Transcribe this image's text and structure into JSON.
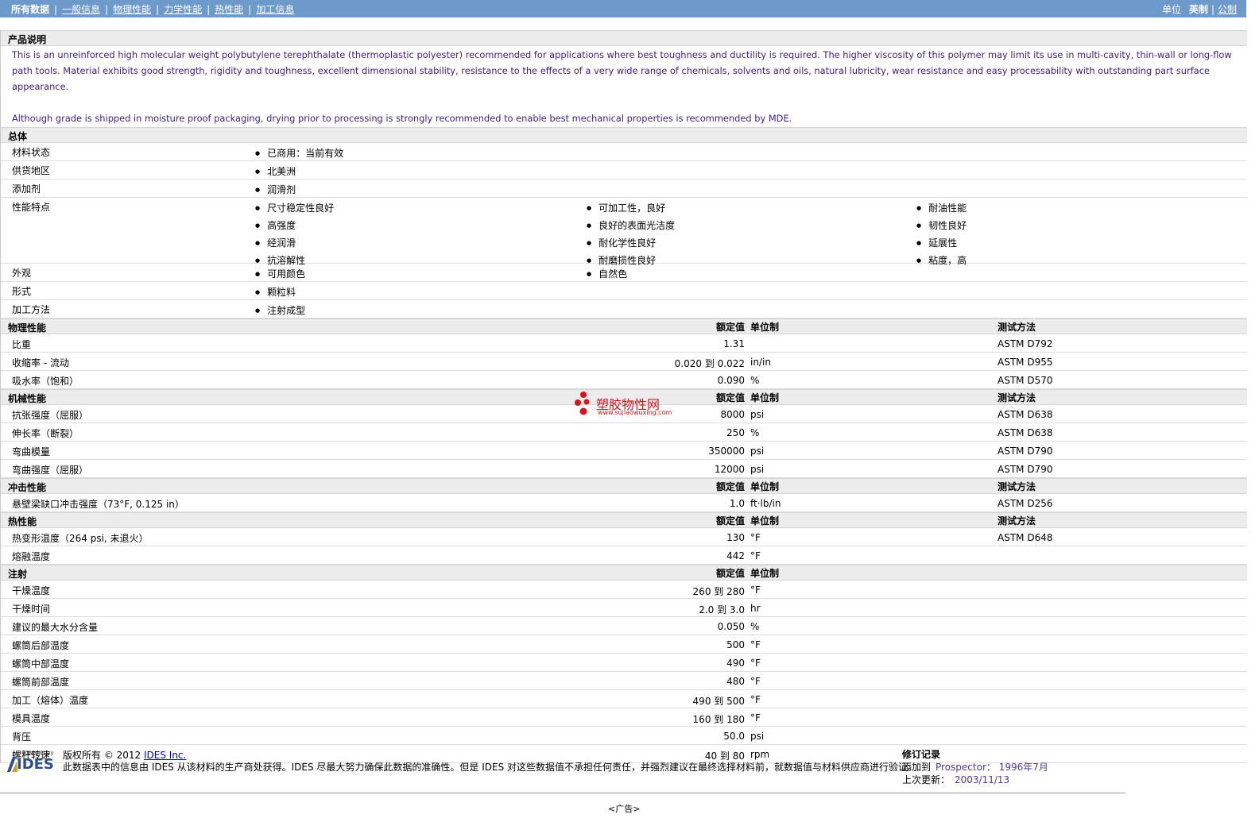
{
  "nav": {
    "items": [
      "所有数据",
      "一般信息",
      "物理性能",
      "力学性能",
      "热性能",
      "加工信息"
    ],
    "units_label": "单位",
    "units": [
      "英制",
      "公制"
    ]
  },
  "description": {
    "title": "产品说明",
    "paragraphs": [
      "This is an unreinforced high molecular weight polybutylene terephthalate (thermoplastic polyester) recommended for applications where best toughness and ductility is required. The higher viscosity of this polymer may limit its use in multi-cavity, thin-wall or long-flow path tools. Material exhibits good strength, rigidity and toughness, excellent dimensional stability, resistance to the effects of a very wide range of chemicals, solvents and oils, natural lubricity, wear resistance and easy processability with outstanding part surface appearance.",
      "Although grade is shipped in moisture proof packaging, drying prior to processing is strongly recommended to enable best mechanical properties is recommended by MDE."
    ],
    "text_color": "#3a1f84"
  },
  "general": {
    "title": "总体",
    "rows": [
      {
        "label": "材料状态",
        "cols": [
          [
            "已商用：当前有效"
          ]
        ]
      },
      {
        "label": "供货地区",
        "cols": [
          [
            "北美洲"
          ]
        ]
      },
      {
        "label": "添加剂",
        "cols": [
          [
            "润滑剂"
          ]
        ]
      },
      {
        "label": "性能特点",
        "cols": [
          [
            "尺寸稳定性良好",
            "高强度",
            "经润滑",
            "抗溶解性"
          ],
          [
            "可加工性，良好",
            "良好的表面光洁度",
            "耐化学性良好",
            "耐磨损性良好"
          ],
          [
            "耐油性能",
            "韧性良好",
            "延展性",
            "粘度，高"
          ]
        ]
      },
      {
        "label": "外观",
        "cols": [
          [
            "可用颜色"
          ],
          [
            "自然色"
          ]
        ]
      },
      {
        "label": "形式",
        "cols": [
          [
            "颗粒料"
          ]
        ]
      },
      {
        "label": "加工方法",
        "cols": [
          [
            "注射成型"
          ]
        ]
      }
    ]
  },
  "col_headers": {
    "nominal": "额定值",
    "unit": "单位制",
    "test": "测试方法"
  },
  "sections": [
    {
      "title": "物理性能",
      "show_test": true,
      "rows": [
        {
          "label": "比重",
          "value": "1.31",
          "unit": "",
          "test": "ASTM D792"
        },
        {
          "label": "收缩率 - 流动",
          "value": "0.020 到  0.022",
          "unit": "in/in",
          "test": "ASTM D955"
        },
        {
          "label": "吸水率（饱和）",
          "value": "0.090",
          "unit": "%",
          "test": "ASTM D570"
        }
      ]
    },
    {
      "title": "机械性能",
      "show_test": true,
      "rows": [
        {
          "label": "抗张强度（屈服）",
          "value": "8000",
          "unit": "psi",
          "test": "ASTM D638"
        },
        {
          "label": "伸长率（断裂）",
          "value": "250",
          "unit": "%",
          "test": "ASTM D638"
        },
        {
          "label": "弯曲模量",
          "value": "350000",
          "unit": "psi",
          "test": "ASTM D790"
        },
        {
          "label": "弯曲强度（屈服）",
          "value": "12000",
          "unit": "psi",
          "test": "ASTM D790"
        }
      ]
    },
    {
      "title": "冲击性能",
      "show_test": true,
      "rows": [
        {
          "label": "悬壁梁缺口冲击强度（73°F, 0.125 in）",
          "value": "1.0",
          "unit": "ft·lb/in",
          "test": "ASTM D256"
        }
      ]
    },
    {
      "title": "热性能",
      "show_test": true,
      "rows": [
        {
          "label": "热变形温度（264 psi, 未退火）",
          "value": "130",
          "unit": "°F",
          "test": "ASTM D648"
        },
        {
          "label": "熔融温度",
          "value": "442",
          "unit": "°F",
          "test": ""
        }
      ]
    },
    {
      "title": "注射",
      "show_test": false,
      "rows": [
        {
          "label": "干燥温度",
          "value": "260 到  280",
          "unit": "°F",
          "test": ""
        },
        {
          "label": "干燥时间",
          "value": "2.0 到  3.0",
          "unit": "hr",
          "test": ""
        },
        {
          "label": "建议的最大水分含量",
          "value": "0.050",
          "unit": "%",
          "test": ""
        },
        {
          "label": "螺筒后部温度",
          "value": "500",
          "unit": "°F",
          "test": ""
        },
        {
          "label": "螺筒中部温度",
          "value": "490",
          "unit": "°F",
          "test": ""
        },
        {
          "label": "螺筒前部温度",
          "value": "480",
          "unit": "°F",
          "test": ""
        },
        {
          "label": "加工（熔体）温度",
          "value": "490 到  500",
          "unit": "°F",
          "test": ""
        },
        {
          "label": "模具温度",
          "value": "160 到  180",
          "unit": "°F",
          "test": ""
        },
        {
          "label": "背压",
          "value": "50.0",
          "unit": "psi",
          "test": ""
        },
        {
          "label": "螺杆转速",
          "value": "40 到  80",
          "unit": "rpm",
          "test": ""
        }
      ]
    }
  ],
  "watermark": {
    "title": "塑胶物性网",
    "url": "www.sujiaowuxing.com"
  },
  "footer": {
    "logo_small": "Powered by",
    "logo_text": "IDES",
    "copyright_prefix": "版权所有  © 2012 ",
    "copyright_link": "IDES Inc.",
    "disclaimer": "此数据表中的信息由  IDES 从该材料的生产商处获得。IDES 尽最大努力确保此数据的准确性。但是  IDES 对这些数据值不承担任何责任，并强烈建议在最终选择材料前，就数据值与材料供应商进行验证。",
    "revision_title": "修订记录",
    "added_label": "添加到",
    "added_value": "Prospector：   1996年7月",
    "updated_label": "上次更新：",
    "updated_value": "2003/11/13"
  },
  "ad_label": "<广告>",
  "colors": {
    "topbar": "#6d9acb",
    "header_bg": "#ececec",
    "watermark": "#d8131b"
  }
}
